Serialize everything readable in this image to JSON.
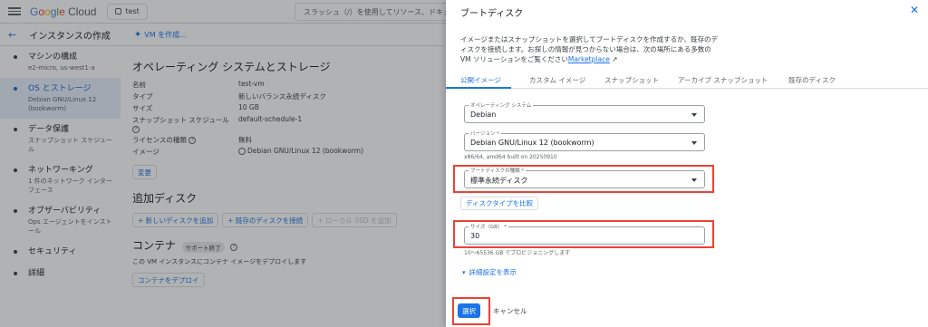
{
  "topbar": {
    "logo_parts": [
      "G",
      "o",
      "o",
      "g",
      "l",
      "e",
      " Cloud"
    ],
    "project": "test",
    "search_placeholder": "スラッシュ（/）を使用してリソース、ドキュメ"
  },
  "subheader": {
    "title": "インスタンスの作成",
    "create_vm": "VM を作成..."
  },
  "nav": {
    "items": [
      {
        "title": "マシンの構成",
        "sub": "e2-micro, us-west1-a"
      },
      {
        "title": "OS とストレージ",
        "sub": "Debian GNU/Linux 12 (bookworm)"
      },
      {
        "title": "データ保護",
        "sub": "スナップショット スケジュール"
      },
      {
        "title": "ネットワーキング",
        "sub": "1 件のネットワーク インターフェース"
      },
      {
        "title": "オブザーバビリティ",
        "sub": "Ops エージェントをインストール"
      },
      {
        "title": "セキュリティ",
        "sub": ""
      },
      {
        "title": "詳細",
        "sub": ""
      }
    ]
  },
  "main": {
    "os_title": "オペレーティング システムとストレージ",
    "rows": [
      {
        "k": "名前",
        "v": "test-vm"
      },
      {
        "k": "タイプ",
        "v": "新しいバランス永続ディスク"
      },
      {
        "k": "サイズ",
        "v": "10 GB"
      },
      {
        "k": "スナップショット スケジュール",
        "v": "default-schedule-1"
      },
      {
        "k": "ライセンスの種類",
        "v": "無料"
      },
      {
        "k": "イメージ",
        "v": "Debian GNU/Linux 12 (bookworm)"
      }
    ],
    "change_btn": "変更",
    "add_disk_title": "追加ディスク",
    "add_new_disk": "+ 新しいディスクを追加",
    "attach_existing": "+ 既存のディスクを接続",
    "add_local_ssd": "+ ローカル SSD を追加",
    "container_title": "コンテナ",
    "container_badge": "サポート終了",
    "container_desc": "この VM インスタンスにコンテナ イメージをデプロイします",
    "deploy_btn": "コンテナをデプロイ"
  },
  "panel": {
    "title": "ブートディスク",
    "close": "✕",
    "desc": "イメージまたはスナップショットを選択してブートディスクを作成するか、既存のディスクを接続します。お探しの情報が見つからない場合は、次の場所にある多数の VM ソリューションをご覧ください",
    "marketplace": "Marketplace",
    "tabs": [
      "公開イメージ",
      "カスタム イメージ",
      "スナップショット",
      "アーカイブ スナップショット",
      "既存のディスク"
    ],
    "os_label": "オペレーティング システム",
    "os_value": "Debian",
    "version_label": "バージョン *",
    "version_value": "Debian GNU/Linux 12 (bookworm)",
    "version_hint": "x86/64, amd64 built on 20250910",
    "disktype_label": "ブートディスクの種類 *",
    "disktype_value": "標準永続ディスク",
    "compare_btn": "ディスクタイプを比較",
    "size_label": "サイズ（GB） *",
    "size_value": "30",
    "size_hint": "10～65536 GB でプロビジョニングします",
    "advanced": "詳細設定を表示",
    "select_btn": "選択",
    "cancel_btn": "キャンセル"
  }
}
